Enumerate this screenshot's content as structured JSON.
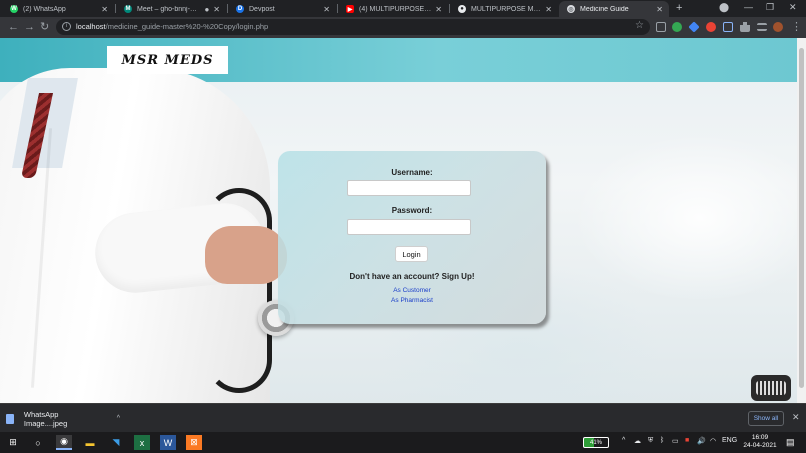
{
  "browser": {
    "tabs": [
      {
        "label": "(2) WhatsApp",
        "fav_color": "#25d366",
        "fav": "W"
      },
      {
        "label": "Meet – gho-bnnj-dgn",
        "fav_color": "#00897b",
        "fav": "M"
      },
      {
        "label": "Devpost",
        "fav_color": "#1a73e8",
        "fav": "D"
      },
      {
        "label": "(4) MULTIPURPOSE MEDICI...",
        "fav_color": "#ff0000",
        "fav": "▶"
      },
      {
        "label": "MULTIPURPOSE MEDICINE...",
        "fav_color": "#e8eaed",
        "fav": "●"
      },
      {
        "label": "Medicine Guide",
        "fav_color": "#dadce0",
        "fav": "◎"
      }
    ],
    "new_tab": "+",
    "window_controls": {
      "minimize": "—",
      "restore": "❐",
      "close": "✕"
    },
    "url_host": "localhost",
    "url_path": "/medicine_guide-master%20-%20Copy/login.php"
  },
  "page": {
    "logo_text": "MSR MEDS",
    "login": {
      "username_label": "Username:",
      "password_label": "Password:",
      "username_value": "",
      "password_value": "",
      "login_button": "Login",
      "signup_prompt": "Don't have an account? Sign Up!",
      "as_customer": "As Customer",
      "as_pharmacist": "As Pharmacist"
    }
  },
  "downloads": {
    "file_name": "WhatsApp Image....jpeg",
    "show_all": "Show all"
  },
  "taskbar": {
    "battery": "41%",
    "language": "ENG",
    "time": "16:09",
    "date": "24-04-2021"
  }
}
